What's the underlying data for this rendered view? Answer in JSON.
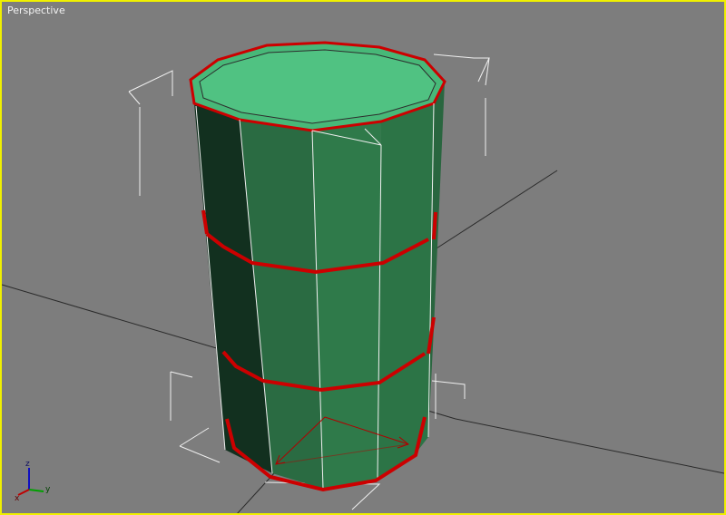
{
  "viewport": {
    "label": "Perspective",
    "border_color": "#f0f000",
    "background_color": "#7d7d7d"
  },
  "object": {
    "type": "cylinder",
    "colors": {
      "top_cap": "#47b878",
      "side_light": "#2f7a4a",
      "side_mid": "#2a6b42",
      "side_dark": "#12301f",
      "selected_edge": "#cc0000",
      "wire": "#f0f0f0"
    }
  },
  "axis_tripod": {
    "x_label": "x",
    "y_label": "y",
    "z_label": "z",
    "x_color": "#c00000",
    "y_color": "#00a000",
    "z_color": "#1010c0"
  },
  "icons": {
    "gizmo": "transform-gizmo-icon",
    "tripod": "axis-tripod-icon"
  }
}
